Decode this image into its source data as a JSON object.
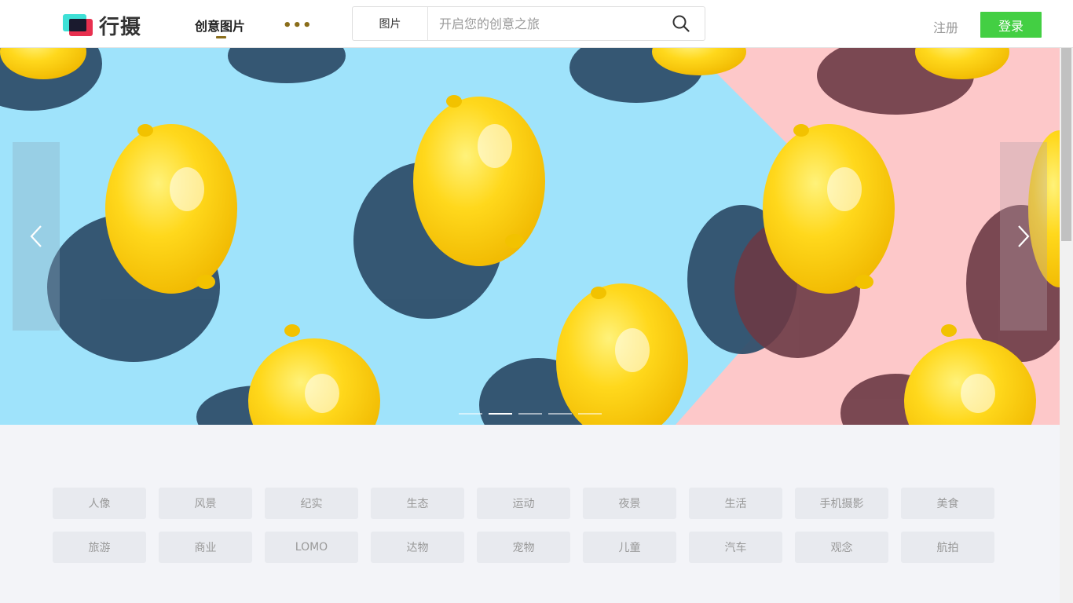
{
  "header": {
    "brand": "行摄",
    "nav_active": "创意图片",
    "nav_more": "•••",
    "search": {
      "type_label": "图片",
      "placeholder": "开启您的创意之旅"
    },
    "register_label": "注册",
    "login_label": "登录"
  },
  "banner": {
    "slide_count": 5,
    "active_index": 1,
    "colors": {
      "sky": "#9fe3fb",
      "pink": "#fdc8c9",
      "lemon": "#ffd21a",
      "shadow": "#2f4f6b"
    }
  },
  "tags": [
    [
      "人像",
      "风景",
      "纪实",
      "生态",
      "运动",
      "夜景",
      "生活",
      "手机摄影",
      "美食"
    ],
    [
      "旅游",
      "商业",
      "LOMO",
      "达物",
      "宠物",
      "儿童",
      "汽车",
      "观念",
      "航拍"
    ]
  ],
  "colors": {
    "accent": "#43cf43",
    "nav_accent": "#8a6d1a",
    "page_bg": "#f3f4f8",
    "tag_bg": "#e8eaef"
  }
}
